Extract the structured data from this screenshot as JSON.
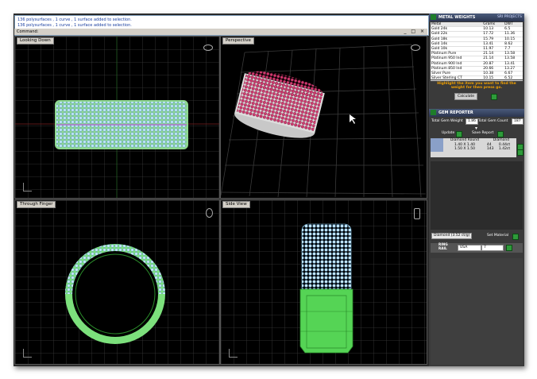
{
  "command": {
    "history": [
      "136 polysurfaces , 1 curve , 1 surface added to selection.",
      "136 polysurfaces , 1 curve , 1 surface added to selection."
    ],
    "prompt_label": "Command:",
    "window_buttons": "_ □ ×"
  },
  "viewports": {
    "top_left": "Looking Down",
    "top_right": "Perspective",
    "bottom_left": "Through Finger",
    "bottom_right": "Side View"
  },
  "metal_weights": {
    "title": "METAL WEIGHTS",
    "subtitle": "SRI PROJECTS",
    "columns": [
      "Metal",
      "Grams",
      "DWT"
    ],
    "rows": [
      [
        "Gold 24k",
        "10.13",
        "6.5"
      ],
      [
        "Gold 22k",
        "17.72",
        "11.36"
      ],
      [
        "Gold 18k",
        "15.79",
        "10.15"
      ],
      [
        "Gold 14k",
        "13.41",
        "8.62"
      ],
      [
        "Gold 10k",
        "11.97",
        "7.7"
      ],
      [
        "Platinum Pure",
        "21.14",
        "13.58"
      ],
      [
        "Platinum 950 Ind",
        "21.14",
        "13.58"
      ],
      [
        "Platinum 900 Ind",
        "20.87",
        "13.41"
      ],
      [
        "Platinum 850 Ind",
        "20.66",
        "13.27"
      ],
      [
        "Silver Pure",
        "10.38",
        "6.67"
      ],
      [
        "Silver Sterling CT",
        "10.15",
        "6.52"
      ]
    ],
    "hint": "Highlight the item you want to find the weight for then press go.",
    "calculate_label": "Calculate"
  },
  "gem_reporter": {
    "title": "GEM REPORTER",
    "total_weight_label": "Total Gem Weight",
    "total_weight_value": "1.86",
    "total_count_label": "Total Gem Count",
    "total_count_value": "187",
    "update_label": "Update",
    "save_report_label": "Save Report",
    "table_columns": [
      "Diamond Round",
      "Diamond"
    ],
    "table_rows": [
      [
        "1.40 X 1.40",
        "44",
        "0.44ct"
      ],
      [
        "1.50 X 1.50",
        "143",
        "1.42ct"
      ]
    ],
    "material_value": "Diamond   (3.52 ct/g)",
    "set_material_label": "Set Material"
  },
  "ring_rail": {
    "label": "RING RAIL",
    "region_value": "USA",
    "size_value": "7"
  },
  "colors": {
    "grid": "#3a3a3a",
    "gem_blue": "#a9d6f2",
    "metal_green": "#5fe05f",
    "ruby": "#c02050"
  }
}
